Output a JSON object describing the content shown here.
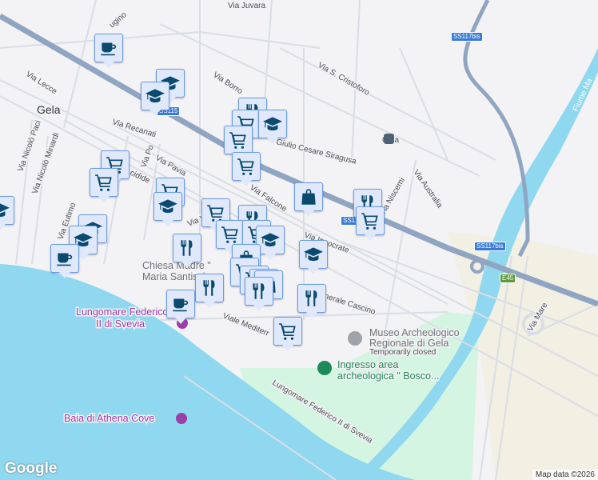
{
  "map": {
    "streets": {
      "via_juvara": "Via Juvara",
      "via_ugino": "ugino",
      "via_lecce": "Via Lecce",
      "via_nicolo_paci": "Via Nicolò Paci",
      "via_nicolo_minardi": "Via Nicolò Minardi",
      "via_recanati": "Via Recanati",
      "via_po": "Via Po",
      "via_pavia": "Via Pavia",
      "cidide": "cidide",
      "via_borro": "Via Borro",
      "via_s_cristoforo": "Via S. Cristoforo",
      "giulio_cesare": "Giulio Cesare Siragusa",
      "via_australia": "Via Australia",
      "via_niscemi": "Via Niscemi",
      "via_falcone": "Via Falcone",
      "via_ver": "Via Ver",
      "via_eutimo": "Via Eutimo",
      "via_ocrate": "Via Ippocrate",
      "via_generale_cascino": "Via Generale Cascino",
      "viale_mediterr": "Viale Mediterr",
      "lungomare_1": "Lungomare Federico II di Svevia",
      "via_mare": "Via Mare",
      "fiume": "Fiume Ma"
    },
    "places": {
      "city": "Gela",
      "station": "Gela",
      "chiesa_line1": "Chiesa Madre \"",
      "chiesa_line2": "Maria Santissi",
      "lungomare_poi_line1": "Lungomare Federico",
      "lungomare_poi_line2": "II di Svevia",
      "museo_line1": "Museo Archeologico",
      "museo_line2": "Regionale di Gela",
      "museo_status": "Temporarily closed",
      "ingresso_line1": "Ingresso area",
      "ingresso_line2": "archeologica \" Bosco...",
      "baia": "Baia di Athena Cove"
    },
    "road_shields": {
      "ss115": "SS115",
      "ss117bis_top": "SS117bis",
      "ss117bis_mid": "SS117bis",
      "ss117bis_right": "SS117bis",
      "e45": "E45"
    },
    "markers": [
      {
        "type": "cafe-icon"
      },
      {
        "type": "education-icon"
      },
      {
        "type": "education-icon"
      },
      {
        "type": "restaurant-icon"
      },
      {
        "type": "shopping-cart-icon"
      },
      {
        "type": "education-icon"
      },
      {
        "type": "shopping-cart-icon"
      },
      {
        "type": "shopping-cart-icon"
      },
      {
        "type": "shopping-cart-icon"
      },
      {
        "type": "shopping-cart-icon"
      },
      {
        "type": "shopping-cart-icon"
      },
      {
        "type": "education-icon"
      },
      {
        "type": "shopping-bag-icon"
      },
      {
        "type": "restaurant-icon"
      },
      {
        "type": "shopping-cart-icon"
      },
      {
        "type": "education-icon"
      },
      {
        "type": "education-icon"
      },
      {
        "type": "education-icon"
      },
      {
        "type": "cafe-icon"
      },
      {
        "type": "shopping-cart-icon"
      },
      {
        "type": "restaurant-icon"
      },
      {
        "type": "shopping-cart-icon"
      },
      {
        "type": "shopping-cart-icon"
      },
      {
        "type": "education-icon"
      },
      {
        "type": "restaurant-icon"
      },
      {
        "type": "education-icon"
      },
      {
        "type": "shopping-bag-icon"
      },
      {
        "type": "shopping-cart-icon"
      },
      {
        "type": "shopping-cart-icon"
      },
      {
        "type": "shopping-cart-icon"
      },
      {
        "type": "restaurant-icon"
      },
      {
        "type": "shopping-bag-icon"
      },
      {
        "type": "restaurant-icon"
      },
      {
        "type": "restaurant-icon"
      },
      {
        "type": "cafe-icon"
      },
      {
        "type": "shopping-cart-icon"
      }
    ],
    "colors": {
      "marker_icon": "#0b4a6e",
      "marker_bg": "#dfe9fb",
      "water": "#8fd8ef",
      "park": "#d4f5e1",
      "highway": "#8fa5c2"
    }
  },
  "footer": {
    "logo": "Google",
    "attribution": "Map data ©2026"
  }
}
